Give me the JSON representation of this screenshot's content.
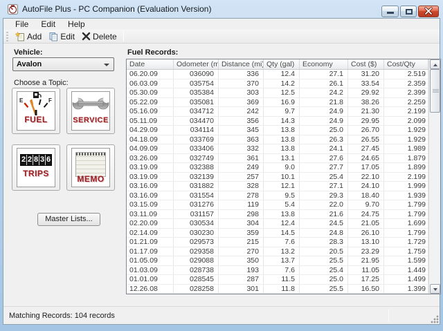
{
  "window": {
    "title": "AutoFile Plus - PC Companion (Evaluation Version)"
  },
  "menu": {
    "items": [
      "File",
      "Edit",
      "Help"
    ]
  },
  "toolbar": {
    "buttons": [
      "Add",
      "Edit",
      "Delete"
    ]
  },
  "sidebar": {
    "vehicle_label": "Vehicle:",
    "vehicle_value": "Avalon",
    "topic_label": "Choose a Topic:",
    "topics": {
      "fuel": "FUEL",
      "service": "SERVICE",
      "trips": "TRIPS",
      "memo": "MEMO"
    },
    "fuel_gauge": {
      "empty": "E",
      "full": "F"
    },
    "trips_odometer": "22836",
    "master_lists": "Master Lists..."
  },
  "main": {
    "section_label": "Fuel Records:",
    "table": {
      "columns": [
        "Date",
        "Odometer (mi)",
        "Distance (mi)",
        "Qty (gal)",
        "Economy",
        "Cost ($)",
        "Cost/Qty"
      ],
      "rows": [
        [
          "06.20.09",
          "036090",
          "336",
          "12.4",
          "27.1",
          "31.20",
          "2.519"
        ],
        [
          "06.03.09",
          "035754",
          "370",
          "14.2",
          "26.1",
          "33.54",
          "2.359"
        ],
        [
          "05.30.09",
          "035384",
          "303",
          "12.5",
          "24.2",
          "29.92",
          "2.399"
        ],
        [
          "05.22.09",
          "035081",
          "369",
          "16.9",
          "21.8",
          "38.26",
          "2.259"
        ],
        [
          "05.16.09",
          "034712",
          "242",
          "9.7",
          "24.9",
          "21.30",
          "2.199"
        ],
        [
          "05.11.09",
          "034470",
          "356",
          "14.3",
          "24.9",
          "29.95",
          "2.099"
        ],
        [
          "04.29.09",
          "034114",
          "345",
          "13.8",
          "25.0",
          "26.70",
          "1.929"
        ],
        [
          "04.18.09",
          "033769",
          "363",
          "13.8",
          "26.3",
          "26.55",
          "1.929"
        ],
        [
          "04.09.09",
          "033406",
          "332",
          "13.8",
          "24.1",
          "27.45",
          "1.989"
        ],
        [
          "03.26.09",
          "032749",
          "361",
          "13.1",
          "27.6",
          "24.65",
          "1.879"
        ],
        [
          "03.19.09",
          "032388",
          "249",
          "9.0",
          "27.7",
          "17.05",
          "1.899"
        ],
        [
          "03.19.09",
          "032139",
          "257",
          "10.1",
          "25.4",
          "22.10",
          "2.199"
        ],
        [
          "03.16.09",
          "031882",
          "328",
          "12.1",
          "27.1",
          "24.10",
          "1.999"
        ],
        [
          "03.16.09",
          "031554",
          "278",
          "9.5",
          "29.3",
          "18.40",
          "1.939"
        ],
        [
          "03.15.09",
          "031276",
          "119",
          "5.4",
          "22.0",
          "9.70",
          "1.799"
        ],
        [
          "03.11.09",
          "031157",
          "298",
          "13.8",
          "21.6",
          "24.75",
          "1.799"
        ],
        [
          "02.20.09",
          "030534",
          "304",
          "12.4",
          "24.5",
          "21.05",
          "1.699"
        ],
        [
          "02.14.09",
          "030230",
          "359",
          "14.5",
          "24.8",
          "26.10",
          "1.799"
        ],
        [
          "01.21.09",
          "029573",
          "215",
          "7.6",
          "28.3",
          "13.10",
          "1.729"
        ],
        [
          "01.17.09",
          "029358",
          "270",
          "13.2",
          "20.5",
          "23.29",
          "1.759"
        ],
        [
          "01.05.09",
          "029088",
          "350",
          "13.7",
          "25.5",
          "21.95",
          "1.599"
        ],
        [
          "01.03.09",
          "028738",
          "193",
          "7.6",
          "25.4",
          "11.05",
          "1.449"
        ],
        [
          "01.01.09",
          "028545",
          "287",
          "11.5",
          "25.0",
          "17.25",
          "1.499"
        ],
        [
          "12.26.08",
          "028258",
          "301",
          "11.8",
          "25.5",
          "16.50",
          "1.399"
        ]
      ]
    }
  },
  "statusbar": {
    "matching_records": "Matching Records:  104 records"
  },
  "icons": {
    "app": "car-gauge-icon",
    "add": "new-record-icon",
    "edit": "copy-pages-icon",
    "delete": "x-cross-icon",
    "fuel": "fuel-gauge-icon",
    "service": "wrench-icon",
    "trips": "odometer-icon",
    "memo": "notepad-icon"
  },
  "colors": {
    "frame_blue": "#a3c6e4",
    "client_bg": "#f0f0f0",
    "close_button_red": "#cf4a2e",
    "topic_text_maroon": "#9e1b1f",
    "grid_line": "#e6e6e6",
    "header_text": "#4a4a4a"
  }
}
